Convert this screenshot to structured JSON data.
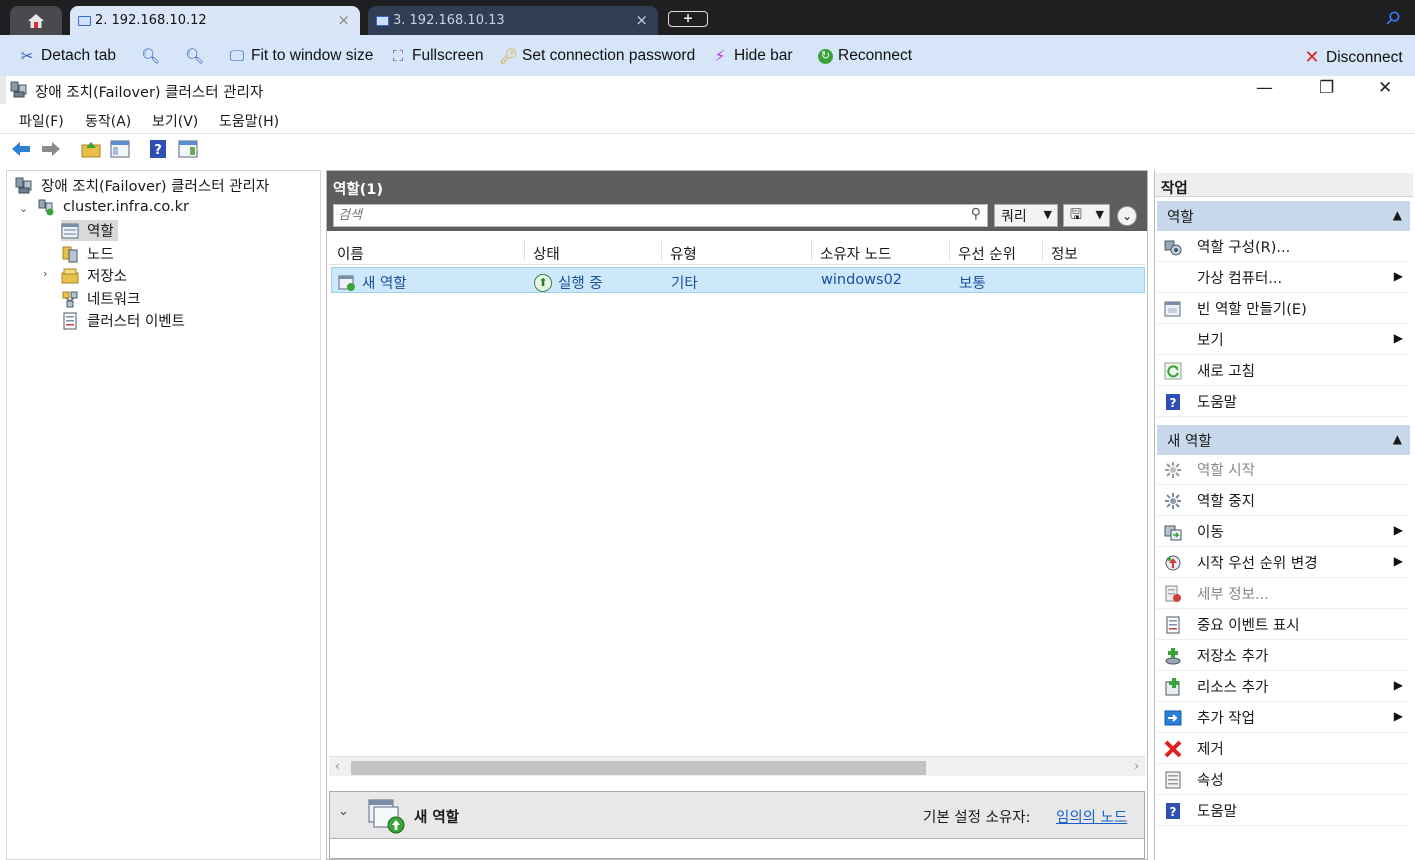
{
  "browser": {
    "tabs": [
      {
        "label": "2. 192.168.10.12",
        "active": true
      },
      {
        "label": "3. 192.168.10.13",
        "active": false
      }
    ],
    "close_glyph": "×",
    "new_tab_glyph": "+"
  },
  "conn_toolbar": {
    "detach": "Detach tab",
    "fit": "Fit to window size",
    "fullscreen": "Fullscreen",
    "set_password": "Set connection password",
    "hide_bar": "Hide bar",
    "reconnect": "Reconnect",
    "disconnect": "Disconnect"
  },
  "window": {
    "title": "장애 조치(Failover) 클러스터 관리자",
    "minimize": "—",
    "restore": "❐",
    "close": "✕"
  },
  "menu": [
    "파일(F)",
    "동작(A)",
    "보기(V)",
    "도움말(H)"
  ],
  "tree": {
    "root": "장애 조치(Failover) 클러스터 관리자",
    "cluster": "cluster.infra.co.kr",
    "children": [
      "역할",
      "노드",
      "저장소",
      "네트워크",
      "클러스터 이벤트"
    ]
  },
  "roles": {
    "title": "역할(1)",
    "search_placeholder": "검색",
    "query_btn": "쿼리",
    "columns": [
      "이름",
      "상태",
      "유형",
      "소유자 노드",
      "우선 순위",
      "정보"
    ],
    "rows": [
      {
        "name": "새 역할",
        "status": "실행 중",
        "type": "기타",
        "owner": "windows02",
        "priority": "보통",
        "info": ""
      }
    ]
  },
  "detail": {
    "name": "새 역할",
    "owner_label": "기본 설정 소유자:",
    "owner_link": "임의의 노드"
  },
  "actions": {
    "title": "작업",
    "section1": "역할",
    "section1_items": [
      {
        "label": "역할 구성(R)...",
        "submenu": false,
        "icon": "configure-role-icon"
      },
      {
        "label": "가상 컴퓨터...",
        "submenu": true,
        "icon": ""
      },
      {
        "label": "빈 역할 만들기(E)",
        "submenu": false,
        "icon": "empty-role-icon"
      },
      {
        "label": "보기",
        "submenu": true,
        "icon": ""
      },
      {
        "label": "새로 고침",
        "submenu": false,
        "icon": "refresh-icon"
      },
      {
        "label": "도움말",
        "submenu": false,
        "icon": "help-icon"
      }
    ],
    "section2": "새 역할",
    "section2_items": [
      {
        "label": "역할 시작",
        "submenu": false,
        "disabled": true,
        "icon": "start-role-icon"
      },
      {
        "label": "역할 중지",
        "submenu": false,
        "disabled": false,
        "icon": "stop-role-icon"
      },
      {
        "label": "이동",
        "submenu": true,
        "disabled": false,
        "icon": "move-icon"
      },
      {
        "label": "시작 우선 순위 변경",
        "submenu": true,
        "disabled": false,
        "icon": "priority-icon"
      },
      {
        "label": "세부 정보...",
        "submenu": false,
        "disabled": true,
        "icon": "details-icon"
      },
      {
        "label": "중요 이벤트 표시",
        "submenu": false,
        "disabled": false,
        "icon": "events-icon"
      },
      {
        "label": "저장소 추가",
        "submenu": false,
        "disabled": false,
        "icon": "add-storage-icon"
      },
      {
        "label": "리소스 추가",
        "submenu": true,
        "disabled": false,
        "icon": "add-resource-icon"
      },
      {
        "label": "추가 작업",
        "submenu": true,
        "disabled": false,
        "icon": "more-actions-icon"
      },
      {
        "label": "제거",
        "submenu": false,
        "disabled": false,
        "icon": "remove-icon"
      },
      {
        "label": "속성",
        "submenu": false,
        "disabled": false,
        "icon": "properties-icon"
      },
      {
        "label": "도움말",
        "submenu": false,
        "disabled": false,
        "icon": "help-icon"
      }
    ]
  },
  "colors": {
    "toolbar_bg": "#d7e5f8",
    "tabstrip_bg": "#1f1f22",
    "header_gray": "#5e5e5e",
    "selection": "#cde8fb",
    "section_blue": "#c9d9ec",
    "link_blue": "#1a5fc8"
  }
}
